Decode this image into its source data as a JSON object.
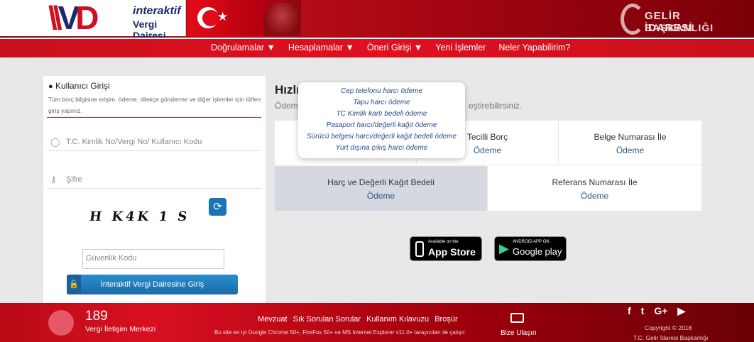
{
  "header": {
    "logo_line1": "interaktif",
    "logo_line2": "Vergi Dairesi",
    "gib_line1": "GELİR İDARESİ",
    "gib_line2": "BAŞKANLIĞI"
  },
  "nav": {
    "items": [
      {
        "label": "Doğrulamalar",
        "caret": "▼"
      },
      {
        "label": "Hesaplamalar",
        "caret": "▼"
      },
      {
        "label": "Öneri Girişi",
        "caret": "▼"
      },
      {
        "label": "Yeni İşlemler",
        "caret": ""
      },
      {
        "label": "Neler Yapabilirim?",
        "caret": ""
      }
    ]
  },
  "login": {
    "title": "Kullanıcı Girişi",
    "description": "Tüm borç bilgisine erişim, ödeme, dilekçe gönderme ve diğer işlemler için lütfen giriş yapınız.",
    "username_placeholder": "T.C. Kimlik No/Vergi No/ Kullanıcı Kodu",
    "password_placeholder": "Şifre",
    "captcha": "H K4K 1 S",
    "security_placeholder": "Güvenlik Kodu",
    "submit_label": "İnteraktif Vergi Dairesine Giriş"
  },
  "main": {
    "title": "Hızlı",
    "subtitle_start": "Ödeme",
    "subtitle_end": "eştirebilirsiniz.",
    "cells": [
      {
        "title": "",
        "sub": ""
      },
      {
        "title": "Tecilli Borç",
        "sub": "Ödeme"
      },
      {
        "title": "Belge Numarası İle",
        "sub": "Ödeme"
      },
      {
        "title": "Harç ve Değerli Kağıt Bedeli",
        "sub": "Ödeme"
      },
      {
        "title": "Referans Numarası İle",
        "sub": "Ödeme"
      }
    ],
    "tooltip_items": [
      "Cep telefonu harcı ödeme",
      "Tapu harcı ödeme",
      "TC Kimlik kartı bedeli ödeme",
      "Pasaport harcı/değerli kağıt ödeme",
      "Sürücü belgesi harcı/değerli kağıt bedeli ödeme",
      "Yurt dışına çıkış harcı ödeme"
    ]
  },
  "stores": {
    "apple_small": "Available on the",
    "apple_big": "App Store",
    "google_small": "ANDROID APP ON",
    "google_big": "Google play"
  },
  "footer": {
    "count": "189",
    "count_label": "Vergi İletişim Merkezi",
    "links": [
      "Mevzuat",
      "Sık Sorulan Sorular",
      "Kullanım Kılavuzu",
      "Broşür"
    ],
    "browser_note": "Bu site en iyi Google Chrome 50+, FireFox 50+ ve MS Internet Explorer v11.0+ tarayıcıları ile çalışır.",
    "contact_label": "Bize Ulaşın",
    "social": [
      "f",
      "t",
      "G+",
      "▶"
    ],
    "copyright1": "Copyright © 2018",
    "copyright2": "T.C. Gelir İdaresi Başkanlığı"
  },
  "colors": {
    "brand_red": "#c8101c",
    "link_blue": "#2a5a8c",
    "button_blue": "#1a6da8"
  }
}
